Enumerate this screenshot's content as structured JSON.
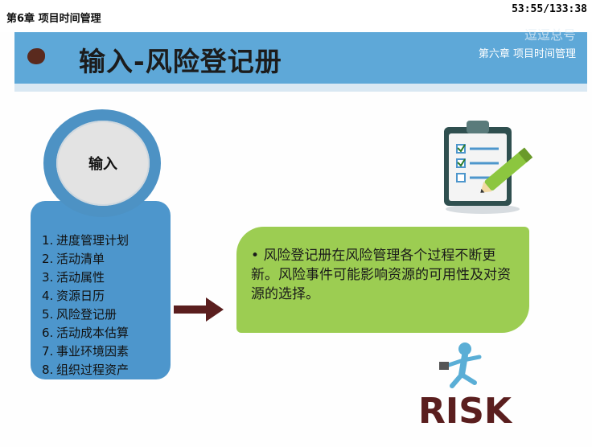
{
  "top_bar": {
    "chapter_label": "第6章 项目时间管理",
    "timer": "53:55/133:38"
  },
  "header": {
    "title": "输入-风险登记册",
    "subtitle": "第六章 项目时间管理",
    "watermark": "逗逗总号"
  },
  "input_circle": {
    "label": "输入"
  },
  "inputs_list": [
    {
      "num": "1.",
      "text": "进度管理计划"
    },
    {
      "num": "2.",
      "text": "活动清单"
    },
    {
      "num": "3.",
      "text": "活动属性"
    },
    {
      "num": "4.",
      "text": "资源日历"
    },
    {
      "num": "5.",
      "text": "风险登记册"
    },
    {
      "num": "6.",
      "text": "活动成本估算"
    },
    {
      "num": "7.",
      "text": "事业环境因素"
    },
    {
      "num": "8.",
      "text": "组织过程资产"
    }
  ],
  "description": {
    "bullet": "•",
    "text": "风险登记册在风险管理各个过程不断更新。风险事件可能影响资源的可用性及对资源的选择。"
  },
  "illustrations": {
    "risk_word": "RISK",
    "clipboard_icon": "clipboard-checklist-icon",
    "runner_icon": "running-man-icon"
  },
  "colors": {
    "header_blue": "#5ea8d8",
    "list_blue": "#4d96cc",
    "green_box": "#9ccd52",
    "arrow_brown": "#5a1e1e",
    "risk_brown": "#5a1e1e"
  }
}
